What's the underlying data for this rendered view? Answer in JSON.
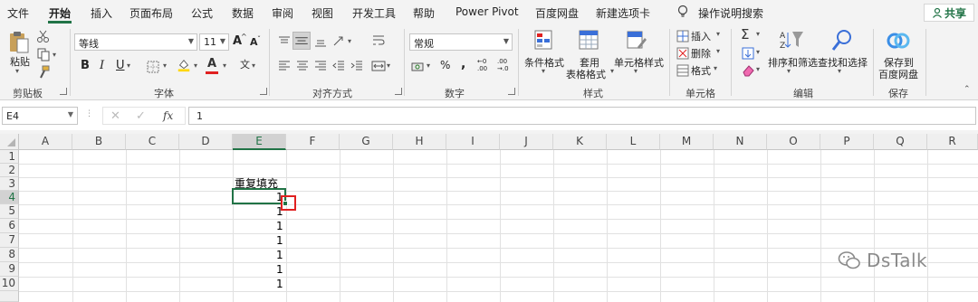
{
  "tabs": [
    "文件",
    "开始",
    "插入",
    "页面布局",
    "公式",
    "数据",
    "审阅",
    "视图",
    "开发工具",
    "帮助",
    "Power Pivot",
    "百度网盘",
    "新建选项卡"
  ],
  "active_tab": "开始",
  "tell_me": "操作说明搜索",
  "share": "共享",
  "ribbon": {
    "clipboard": {
      "paste": "粘贴",
      "label": "剪贴板"
    },
    "font": {
      "name": "等线",
      "size": "11",
      "label": "字体",
      "grow": "A",
      "shrink": "A",
      "bold": "B",
      "italic": "I",
      "underline": "U",
      "wen": "文"
    },
    "alignment": {
      "label": "对齐方式"
    },
    "number": {
      "format": "常规",
      "label": "数字",
      "percent": "%",
      "comma": ",",
      "inc": ".0→.00",
      "dec": ".00→.0"
    },
    "styles": {
      "conditional": "条件格式",
      "table_line1": "套用",
      "table_line2": "表格格式",
      "cell_styles": "单元格样式",
      "label": "样式"
    },
    "cells": {
      "insert": "插入",
      "delete": "删除",
      "format": "格式",
      "label": "单元格"
    },
    "editing": {
      "sigma": "Σ",
      "sort": "排序和筛选",
      "find": "查找和选择",
      "label": "编辑"
    },
    "save": {
      "line1": "保存到",
      "line2": "百度网盘",
      "label": "保存"
    }
  },
  "formula_bar": {
    "name_box": "E4",
    "fx": "fx",
    "value": "1"
  },
  "columns": [
    "A",
    "B",
    "C",
    "D",
    "E",
    "F",
    "G",
    "H",
    "I",
    "J",
    "K",
    "L",
    "M",
    "N",
    "O",
    "P",
    "Q",
    "R"
  ],
  "selected_column": "E",
  "rows": [
    "1",
    "2",
    "3",
    "4",
    "5",
    "6",
    "7",
    "8",
    "9",
    "10"
  ],
  "selected_row": "4",
  "cells": {
    "E3": "重复填充",
    "E4": "1",
    "E5": "1",
    "E6": "1",
    "E7": "1",
    "E8": "1",
    "E9": "1",
    "E10": "1"
  },
  "watermark": "DsTalk",
  "colors": {
    "accent": "#217346",
    "highlight": "#e02020",
    "font_color": "#e02020",
    "fill_color": "#ffd700"
  }
}
